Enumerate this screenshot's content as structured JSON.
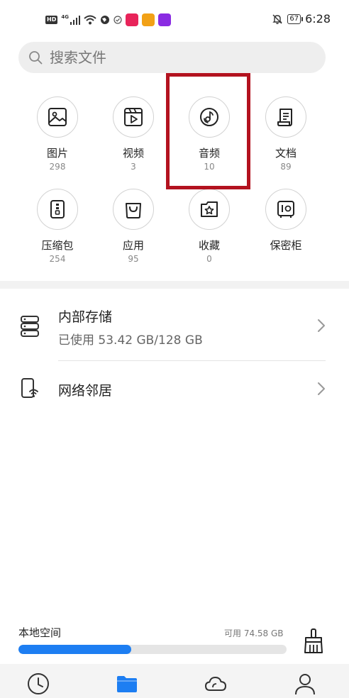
{
  "status_bar": {
    "hd": "HD",
    "network": "4G",
    "battery": "67",
    "time": "6:28"
  },
  "search": {
    "placeholder": "搜索文件"
  },
  "categories": [
    {
      "label": "图片",
      "count": "298",
      "icon": "image-icon"
    },
    {
      "label": "视频",
      "count": "3",
      "icon": "video-icon"
    },
    {
      "label": "音频",
      "count": "10",
      "icon": "music-icon"
    },
    {
      "label": "文档",
      "count": "89",
      "icon": "document-icon"
    },
    {
      "label": "压缩包",
      "count": "254",
      "icon": "zip-icon"
    },
    {
      "label": "应用",
      "count": "95",
      "icon": "shopping-bag-icon"
    },
    {
      "label": "收藏",
      "count": "0",
      "icon": "star-folder-icon"
    },
    {
      "label": "保密柜",
      "count": "",
      "icon": "safe-icon"
    }
  ],
  "storage": {
    "internal_title": "内部存储",
    "internal_usage": "已使用 53.42 GB/128 GB",
    "network_title": "网络邻居"
  },
  "local_space": {
    "label": "本地空间",
    "available": "可用 74.58 GB",
    "used_fraction": 0.42
  },
  "colors": {
    "accent": "#1d7ef2",
    "highlight": "#b3121f"
  },
  "bottom_nav": [
    "recent-clock-icon",
    "folder-icon",
    "cloud-icon",
    "profile-icon"
  ]
}
